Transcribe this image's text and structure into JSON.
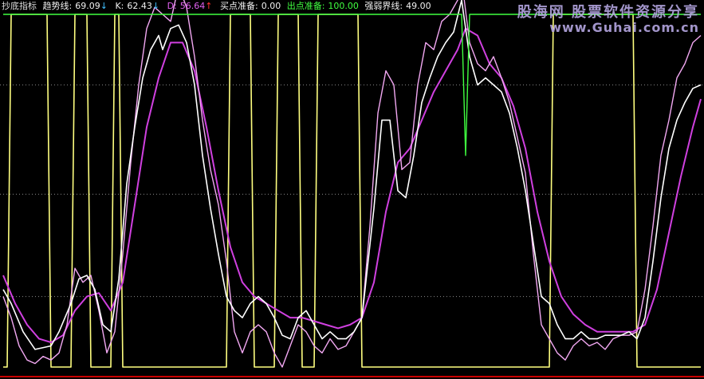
{
  "header": {
    "title": "抄底指标",
    "trend": {
      "label": "趋势线:",
      "value": "69.09",
      "arrow": "↓"
    },
    "k": {
      "label": "K:",
      "value": "62.43",
      "arrow": "↓"
    },
    "d": {
      "label": "D:",
      "value": "56.64",
      "arrow": "↑"
    },
    "buy": {
      "label": "买点准备:",
      "value": "0.00"
    },
    "sell": {
      "label": "出点准备:",
      "value": "100.00"
    },
    "strength": {
      "label": "强弱界线:",
      "value": "49.00"
    }
  },
  "watermark": {
    "line1": "股海网 股票软件资源分享",
    "line2": "www.Guhai.com.cn"
  },
  "colors": {
    "background": "#000000",
    "trend": "#ffffff",
    "k": "#f2a8f2",
    "d": "#d040e0",
    "buy": "#ffff80",
    "sell": "#40ff40",
    "strength": "#ffffff",
    "grid": "#8a8a8a",
    "bottom_axis": "#c80000",
    "up_arrow": "#ff3030",
    "down_arrow": "#40c0ff"
  },
  "chart_data": {
    "type": "line",
    "ylim": [
      0,
      100
    ],
    "gridlines": [
      20,
      49,
      80
    ],
    "n": 176,
    "series": [
      {
        "name": "趋势线",
        "key": "trend",
        "points": [
          [
            0,
            22
          ],
          [
            2,
            18
          ],
          [
            5,
            10
          ],
          [
            8,
            5
          ],
          [
            12,
            6
          ],
          [
            14,
            10
          ],
          [
            17,
            18
          ],
          [
            19,
            25
          ],
          [
            21,
            26
          ],
          [
            23,
            22
          ],
          [
            25,
            12
          ],
          [
            27,
            10
          ],
          [
            29,
            25
          ],
          [
            31,
            52
          ],
          [
            33,
            68
          ],
          [
            35,
            82
          ],
          [
            37,
            90
          ],
          [
            39,
            94
          ],
          [
            40,
            90
          ],
          [
            42,
            96
          ],
          [
            44,
            97
          ],
          [
            46,
            92
          ],
          [
            48,
            80
          ],
          [
            50,
            60
          ],
          [
            52,
            45
          ],
          [
            54,
            32
          ],
          [
            56,
            20
          ],
          [
            58,
            16
          ],
          [
            60,
            14
          ],
          [
            62,
            18
          ],
          [
            64,
            20
          ],
          [
            66,
            18
          ],
          [
            68,
            14
          ],
          [
            70,
            9
          ],
          [
            72,
            8
          ],
          [
            74,
            14
          ],
          [
            76,
            16
          ],
          [
            78,
            12
          ],
          [
            80,
            8
          ],
          [
            82,
            10
          ],
          [
            84,
            8
          ],
          [
            86,
            8
          ],
          [
            88,
            10
          ],
          [
            90,
            14
          ],
          [
            93,
            45
          ],
          [
            95,
            70
          ],
          [
            97,
            70
          ],
          [
            99,
            50
          ],
          [
            101,
            48
          ],
          [
            103,
            60
          ],
          [
            105,
            75
          ],
          [
            107,
            82
          ],
          [
            109,
            88
          ],
          [
            111,
            92
          ],
          [
            113,
            95
          ],
          [
            115,
            104
          ],
          [
            117,
            88
          ],
          [
            119,
            80
          ],
          [
            121,
            82
          ],
          [
            123,
            80
          ],
          [
            125,
            78
          ],
          [
            127,
            72
          ],
          [
            129,
            62
          ],
          [
            131,
            50
          ],
          [
            133,
            35
          ],
          [
            135,
            20
          ],
          [
            137,
            18
          ],
          [
            139,
            12
          ],
          [
            141,
            8
          ],
          [
            143,
            8
          ],
          [
            145,
            10
          ],
          [
            147,
            8
          ],
          [
            149,
            8
          ],
          [
            151,
            9
          ],
          [
            153,
            9
          ],
          [
            155,
            9
          ],
          [
            157,
            10
          ],
          [
            159,
            8
          ],
          [
            161,
            14
          ],
          [
            163,
            30
          ],
          [
            165,
            48
          ],
          [
            167,
            62
          ],
          [
            169,
            70
          ],
          [
            171,
            75
          ],
          [
            173,
            79
          ],
          [
            175,
            80
          ]
        ]
      },
      {
        "name": "K",
        "key": "k",
        "points": [
          [
            0,
            20
          ],
          [
            2,
            14
          ],
          [
            4,
            6
          ],
          [
            6,
            2
          ],
          [
            8,
            1
          ],
          [
            10,
            3
          ],
          [
            12,
            2
          ],
          [
            14,
            4
          ],
          [
            16,
            12
          ],
          [
            18,
            28
          ],
          [
            20,
            24
          ],
          [
            22,
            26
          ],
          [
            24,
            16
          ],
          [
            26,
            4
          ],
          [
            28,
            10
          ],
          [
            30,
            32
          ],
          [
            32,
            58
          ],
          [
            34,
            80
          ],
          [
            36,
            96
          ],
          [
            38,
            102
          ],
          [
            40,
            100
          ],
          [
            42,
            98
          ],
          [
            44,
            108
          ],
          [
            46,
            102
          ],
          [
            48,
            88
          ],
          [
            50,
            70
          ],
          [
            52,
            56
          ],
          [
            54,
            46
          ],
          [
            56,
            30
          ],
          [
            58,
            10
          ],
          [
            60,
            4
          ],
          [
            62,
            10
          ],
          [
            64,
            12
          ],
          [
            66,
            10
          ],
          [
            68,
            4
          ],
          [
            70,
            0
          ],
          [
            72,
            6
          ],
          [
            74,
            12
          ],
          [
            76,
            10
          ],
          [
            78,
            6
          ],
          [
            80,
            4
          ],
          [
            82,
            8
          ],
          [
            84,
            5
          ],
          [
            86,
            6
          ],
          [
            88,
            10
          ],
          [
            90,
            14
          ],
          [
            92,
            40
          ],
          [
            94,
            72
          ],
          [
            96,
            84
          ],
          [
            98,
            80
          ],
          [
            100,
            56
          ],
          [
            102,
            58
          ],
          [
            104,
            80
          ],
          [
            106,
            92
          ],
          [
            108,
            90
          ],
          [
            110,
            98
          ],
          [
            112,
            100
          ],
          [
            114,
            104
          ],
          [
            115,
            110
          ],
          [
            117,
            92
          ],
          [
            119,
            86
          ],
          [
            121,
            84
          ],
          [
            123,
            88
          ],
          [
            125,
            82
          ],
          [
            127,
            75
          ],
          [
            129,
            65
          ],
          [
            131,
            55
          ],
          [
            133,
            32
          ],
          [
            135,
            12
          ],
          [
            137,
            8
          ],
          [
            139,
            4
          ],
          [
            141,
            2
          ],
          [
            143,
            6
          ],
          [
            145,
            8
          ],
          [
            147,
            6
          ],
          [
            149,
            7
          ],
          [
            151,
            5
          ],
          [
            153,
            8
          ],
          [
            155,
            9
          ],
          [
            157,
            9
          ],
          [
            159,
            10
          ],
          [
            161,
            22
          ],
          [
            163,
            40
          ],
          [
            165,
            60
          ],
          [
            167,
            70
          ],
          [
            169,
            82
          ],
          [
            171,
            86
          ],
          [
            173,
            92
          ],
          [
            175,
            94
          ]
        ]
      },
      {
        "name": "D",
        "key": "d",
        "points": [
          [
            0,
            26
          ],
          [
            3,
            18
          ],
          [
            6,
            12
          ],
          [
            9,
            8
          ],
          [
            12,
            7
          ],
          [
            15,
            9
          ],
          [
            18,
            16
          ],
          [
            21,
            20
          ],
          [
            24,
            21
          ],
          [
            27,
            16
          ],
          [
            30,
            24
          ],
          [
            33,
            46
          ],
          [
            36,
            68
          ],
          [
            39,
            82
          ],
          [
            42,
            92
          ],
          [
            45,
            92
          ],
          [
            48,
            84
          ],
          [
            51,
            68
          ],
          [
            54,
            50
          ],
          [
            57,
            34
          ],
          [
            60,
            24
          ],
          [
            63,
            20
          ],
          [
            66,
            18
          ],
          [
            69,
            16
          ],
          [
            72,
            14
          ],
          [
            75,
            14
          ],
          [
            78,
            13
          ],
          [
            81,
            12
          ],
          [
            84,
            11
          ],
          [
            87,
            12
          ],
          [
            90,
            14
          ],
          [
            93,
            24
          ],
          [
            96,
            44
          ],
          [
            99,
            58
          ],
          [
            102,
            62
          ],
          [
            105,
            70
          ],
          [
            108,
            78
          ],
          [
            111,
            84
          ],
          [
            114,
            90
          ],
          [
            116,
            96
          ],
          [
            119,
            94
          ],
          [
            122,
            86
          ],
          [
            125,
            82
          ],
          [
            128,
            74
          ],
          [
            131,
            62
          ],
          [
            134,
            44
          ],
          [
            137,
            30
          ],
          [
            140,
            20
          ],
          [
            143,
            15
          ],
          [
            146,
            12
          ],
          [
            149,
            10
          ],
          [
            152,
            10
          ],
          [
            155,
            10
          ],
          [
            158,
            10
          ],
          [
            161,
            12
          ],
          [
            164,
            22
          ],
          [
            167,
            38
          ],
          [
            170,
            54
          ],
          [
            173,
            68
          ],
          [
            175,
            76
          ]
        ]
      },
      {
        "name": "买点准备",
        "key": "buy",
        "points": [
          [
            0,
            0
          ],
          [
            1,
            0
          ],
          [
            2,
            100
          ],
          [
            11,
            100
          ],
          [
            12,
            0
          ],
          [
            17,
            0
          ],
          [
            18,
            100
          ],
          [
            21,
            100
          ],
          [
            22,
            0
          ],
          [
            27,
            0
          ],
          [
            28,
            100
          ],
          [
            29,
            100
          ],
          [
            30,
            0
          ],
          [
            56,
            0
          ],
          [
            57,
            100
          ],
          [
            62,
            100
          ],
          [
            63,
            0
          ],
          [
            68,
            0
          ],
          [
            69,
            100
          ],
          [
            74,
            100
          ],
          [
            75,
            0
          ],
          [
            78,
            0
          ],
          [
            79,
            100
          ],
          [
            89,
            100
          ],
          [
            90,
            0
          ],
          [
            137,
            0
          ],
          [
            138,
            100
          ],
          [
            158,
            100
          ],
          [
            159,
            0
          ],
          [
            175,
            0
          ]
        ]
      },
      {
        "name": "出点准备",
        "key": "sell",
        "points": [
          [
            0,
            100
          ],
          [
            115,
            100
          ],
          [
            116,
            60
          ],
          [
            117,
            100
          ],
          [
            175,
            100
          ]
        ]
      },
      {
        "name": "强弱界线",
        "key": "strength",
        "points": [
          [
            0,
            49
          ],
          [
            175,
            49
          ]
        ]
      }
    ]
  }
}
